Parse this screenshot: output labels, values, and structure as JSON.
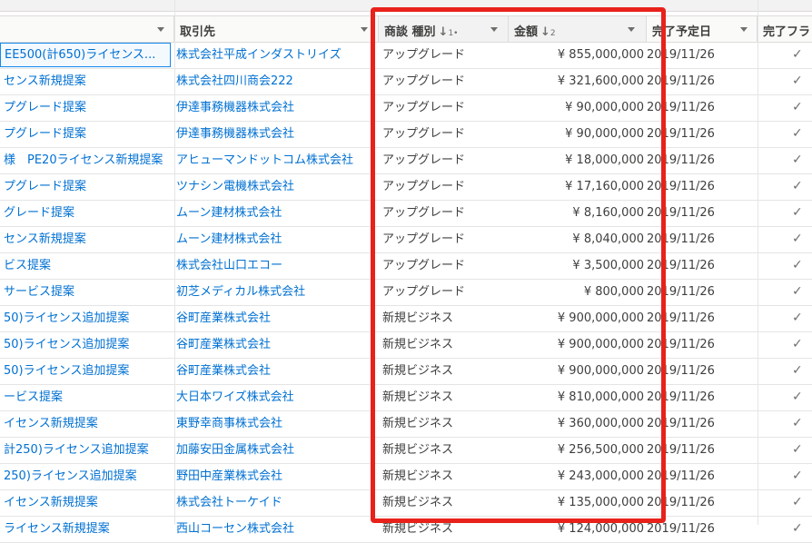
{
  "columns": {
    "type_label": "商談 種別",
    "type_sort": "↓",
    "type_sort_index": "1",
    "type_sort_mark": "•",
    "account_label": "取引先",
    "amount_label": "金額",
    "amount_sort": "↓",
    "amount_sort_index": "2",
    "close_date_label": "完了予定日",
    "completed_label": "完了フラ"
  },
  "rows": [
    {
      "name": "EE500(計650)ライセンス...",
      "account": "株式会社平成インダストリイズ",
      "type": "アップグレード",
      "amount": "¥ 855,000,000",
      "close_date": "2019/11/26",
      "completed": "✓"
    },
    {
      "name": "センス新規提案",
      "account": "株式会社四川商会222",
      "type": "アップグレード",
      "amount": "¥ 321,600,000",
      "close_date": "2019/11/26",
      "completed": "✓"
    },
    {
      "name": "プグレード提案",
      "account": "伊達事務機器株式会社",
      "type": "アップグレード",
      "amount": "¥ 90,000,000",
      "close_date": "2019/11/26",
      "completed": "✓"
    },
    {
      "name": "プグレード提案",
      "account": "伊達事務機器株式会社",
      "type": "アップグレード",
      "amount": "¥ 90,000,000",
      "close_date": "2019/11/26",
      "completed": "✓"
    },
    {
      "name": "様　PE20ライセンス新規提案",
      "account": "アヒューマンドットコム株式会社",
      "type": "アップグレード",
      "amount": "¥ 18,000,000",
      "close_date": "2019/11/26",
      "completed": "✓"
    },
    {
      "name": "プグレード提案",
      "account": "ツナシン電機株式会社",
      "type": "アップグレード",
      "amount": "¥ 17,160,000",
      "close_date": "2019/11/26",
      "completed": "✓"
    },
    {
      "name": "グレード提案",
      "account": "ムーン建材株式会社",
      "type": "アップグレード",
      "amount": "¥ 8,160,000",
      "close_date": "2019/11/26",
      "completed": "✓"
    },
    {
      "name": "センス新規提案",
      "account": "ムーン建材株式会社",
      "type": "アップグレード",
      "amount": "¥ 8,040,000",
      "close_date": "2019/11/26",
      "completed": "✓"
    },
    {
      "name": "ビス提案",
      "account": "株式会社山口エコー",
      "type": "アップグレード",
      "amount": "¥ 3,500,000",
      "close_date": "2019/11/26",
      "completed": "✓"
    },
    {
      "name": "サービス提案",
      "account": "初芝メディカル株式会社",
      "type": "アップグレード",
      "amount": "¥ 800,000",
      "close_date": "2019/11/26",
      "completed": "✓"
    },
    {
      "name": "50)ライセンス追加提案",
      "account": "谷町産業株式会社",
      "type": "新規ビジネス",
      "amount": "¥ 900,000,000",
      "close_date": "2019/11/26",
      "completed": "✓"
    },
    {
      "name": "50)ライセンス追加提案",
      "account": "谷町産業株式会社",
      "type": "新規ビジネス",
      "amount": "¥ 900,000,000",
      "close_date": "2019/11/26",
      "completed": "✓"
    },
    {
      "name": "50)ライセンス追加提案",
      "account": "谷町産業株式会社",
      "type": "新規ビジネス",
      "amount": "¥ 900,000,000",
      "close_date": "2019/11/26",
      "completed": "✓"
    },
    {
      "name": "ービス提案",
      "account": "大日本ワイズ株式会社",
      "type": "新規ビジネス",
      "amount": "¥ 810,000,000",
      "close_date": "2019/11/26",
      "completed": "✓"
    },
    {
      "name": "イセンス新規提案",
      "account": "東野幸商事株式会社",
      "type": "新規ビジネス",
      "amount": "¥ 360,000,000",
      "close_date": "2019/11/26",
      "completed": "✓"
    },
    {
      "name": "計250)ライセンス追加提案",
      "account": "加藤安田金属株式会社",
      "type": "新規ビジネス",
      "amount": "¥ 256,500,000",
      "close_date": "2019/11/26",
      "completed": "✓"
    },
    {
      "name": "250)ライセンス追加提案",
      "account": "野田中産業株式会社",
      "type": "新規ビジネス",
      "amount": "¥ 243,000,000",
      "close_date": "2019/11/26",
      "completed": "✓"
    },
    {
      "name": "イセンス新規提案",
      "account": "株式会社トーケイド",
      "type": "新規ビジネス",
      "amount": "¥ 135,000,000",
      "close_date": "2019/11/26",
      "completed": "✓"
    },
    {
      "name": "ライセンス新規提案",
      "account": "西山コーセン株式会社",
      "type": "新規ビジネス",
      "amount": "¥ 124,000,000",
      "close_date": "2019/11/26",
      "completed": "✓"
    }
  ],
  "highlight_color": "#e8221b"
}
